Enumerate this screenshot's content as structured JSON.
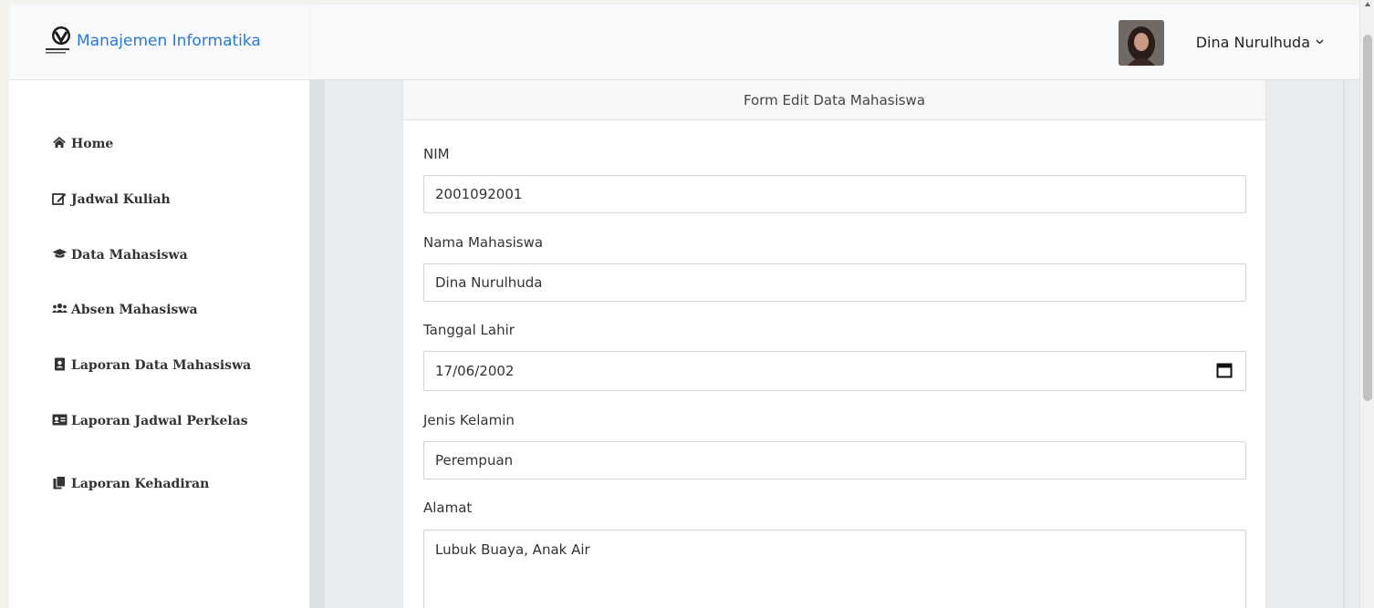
{
  "brand": {
    "name": "Manajemen Informatika",
    "logo_text": "MANAJEMEN INFORMATIKA"
  },
  "header": {
    "user_name": "Dina Nurulhuda"
  },
  "sidebar": {
    "items": [
      {
        "label": "Home",
        "icon": "home-icon"
      },
      {
        "label": "Jadwal Kuliah",
        "icon": "edit-icon"
      },
      {
        "label": "Data Mahasiswa",
        "icon": "graduation-cap-icon"
      },
      {
        "label": "Absen Mahasiswa",
        "icon": "users-icon"
      },
      {
        "label": "Laporan Data Mahasiswa",
        "icon": "contact-book-icon"
      },
      {
        "label": "Laporan Jadwal Perkelas",
        "icon": "id-card-icon"
      },
      {
        "label": "Laporan Kehadiran",
        "icon": "copy-icon"
      }
    ]
  },
  "form": {
    "title": "Form Edit Data Mahasiswa",
    "fields": {
      "nim": {
        "label": "NIM",
        "value": "2001092001"
      },
      "nama": {
        "label": "Nama Mahasiswa",
        "value": "Dina Nurulhuda"
      },
      "tanggal_lahir": {
        "label": "Tanggal Lahir",
        "value": "17/06/2002"
      },
      "jenis_kelamin": {
        "label": "Jenis Kelamin",
        "value": "Perempuan"
      },
      "alamat": {
        "label": "Alamat",
        "value": "Lubuk Buaya, Anak Air"
      }
    }
  },
  "colors": {
    "brand": "#2979d9",
    "sidebar_bg": "#ffffff",
    "header_bg": "#f8f9fa",
    "content_bg": "#e9ecef"
  }
}
